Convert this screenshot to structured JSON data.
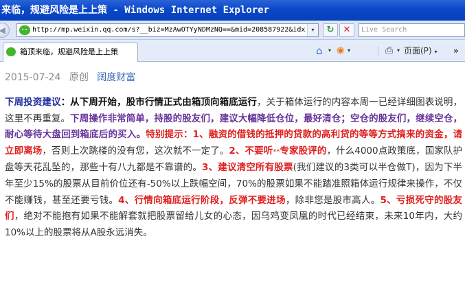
{
  "window": {
    "title": "来临，规避风险是上上策 - Windows Internet Explorer"
  },
  "address_bar": {
    "url": "http://mp.weixin.qq.com/s?__biz=MzAwOTYyNDMzNQ==&mid=208587922&idx",
    "search_placeholder": "Live Search"
  },
  "toolbar": {
    "refresh_glyph": "↻",
    "stop_glyph": "✕",
    "page_menu_label": "页面(P)",
    "dropdown_glyph": "▾",
    "more_glyph": "»"
  },
  "tab": {
    "label": "箱顶来临，规避风险是上上策"
  },
  "icons": {
    "back": "back-arrow-icon",
    "wechat": "wechat-icon",
    "favorites": "favorites-star-icon",
    "add_favorites": "add-favorites-icon",
    "home": "home-icon",
    "feeds": "feeds-icon",
    "print": "printer-icon"
  },
  "article": {
    "date": "2015-07-24",
    "original": "原创",
    "account": "阔度财富",
    "p_label": "下周投资建议",
    "p_colon": "：",
    "p_lead": "从下周开始，股市行情正式由箱顶向箱底运行",
    "p_text1": "，关于箱体运行的内容本周一已经详细图表说明，这里不再重复。",
    "p_purple": "下周操作非常简单，持股的股友们，建议大幅降低仓位，最好清仓；空仓的股友们，继续空仓，耐心等待大盘回到箱底后的买入。",
    "p_tips": "特别提示：",
    "p_r1": "1、融资的借钱的抵押的贷款的高利贷的等等方式搞来的资金，请立即离场",
    "p_t1": "，否则上次跳楼的没有您，这次就不一定了。",
    "p_r2": "2、不要听",
    "p_r2_small": "**",
    "p_r2b": "专家股评的",
    "p_t2": "，什么4000点政策底，国家队护盘等天花乱坠的，那些十有八九都是不靠谱的。",
    "p_r3": "3、建议清空所有股票",
    "p_t3": "(我们建议的3类可以半仓做T)，因为下半年至少15%的股票从目前价位还有-50%以上跌幅空间，70%的股票如果不能踏准照箱体运行规律来操作，不仅不能赚钱，甚至还要亏钱。",
    "p_r4": "4、行情向箱底运行阶段，反弹不要进场",
    "p_t4": "，除非您是股市高人。",
    "p_r5": "5、亏损死守的股友们",
    "p_t5": "，绝对不能抱有如果不能解套就把股票留给儿女的心态，因乌鸡变凤凰的时代已经结束，未来10年内，大约10%以上的股票将从A股永远消失。"
  }
}
